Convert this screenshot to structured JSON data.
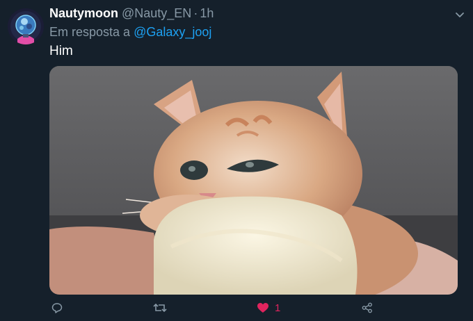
{
  "tweet": {
    "display_name": "Nautymoon",
    "handle": "@Nauty_EN",
    "separator": "·",
    "time": "1h",
    "reply_prefix": "Em resposta a",
    "reply_mention": "@Galaxy_jooj",
    "text": "Him",
    "like_count": "1"
  },
  "colors": {
    "background": "#15202b",
    "name": "#ffffff",
    "secondary": "#8899a6",
    "link": "#1da1f2",
    "like": "#e0245e"
  },
  "icons": {
    "caret": "chevron-down-icon",
    "reply": "reply-icon",
    "retweet": "retweet-icon",
    "like": "heart-icon",
    "share": "share-icon"
  }
}
